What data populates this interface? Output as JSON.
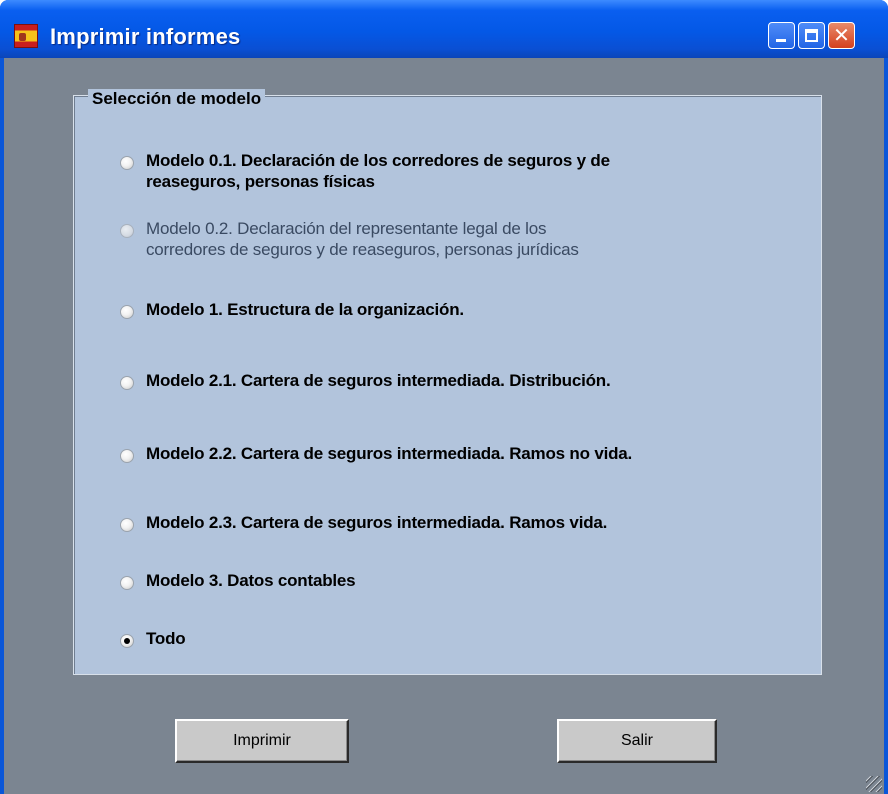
{
  "window": {
    "title": "Imprimir informes",
    "controls": {
      "minimize": "_",
      "maximize": "□",
      "close": "✕"
    }
  },
  "group": {
    "legend": "Selección de modelo",
    "options": [
      {
        "label_line1": "Modelo 0.1. Declaración de los corredores de seguros y de",
        "label_line2": "reaseguros, personas físicas",
        "checked": false,
        "enabled": true
      },
      {
        "label_line1": "Modelo 0.2. Declaración del representante legal de los",
        "label_line2": "corredores de seguros y de reaseguros, personas jurídicas",
        "checked": false,
        "enabled": false
      },
      {
        "label_line1": "Modelo 1. Estructura de la organización.",
        "checked": false,
        "enabled": true
      },
      {
        "label_line1": "Modelo 2.1. Cartera de seguros intermediada. Distribución.",
        "checked": false,
        "enabled": true
      },
      {
        "label_line1": "Modelo 2.2. Cartera de seguros intermediada. Ramos no vida.",
        "checked": false,
        "enabled": true
      },
      {
        "label_line1": "Modelo 2.3. Cartera de seguros intermediada. Ramos vida.",
        "checked": false,
        "enabled": true
      },
      {
        "label_line1": "Modelo 3. Datos contables",
        "checked": false,
        "enabled": true
      },
      {
        "label_line1": "Todo",
        "checked": true,
        "enabled": true
      }
    ]
  },
  "buttons": {
    "print": "Imprimir",
    "exit": "Salir"
  },
  "colors": {
    "titlebar": "#0458e6",
    "client": "#7b8591",
    "groupbox": "#b2c4dc",
    "button": "#c9c9c9"
  },
  "icons": [
    "app-flag-icon",
    "minimize-icon",
    "maximize-icon",
    "close-icon",
    "resize-grip-icon"
  ]
}
